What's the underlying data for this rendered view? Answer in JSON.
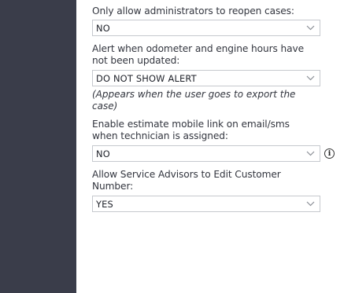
{
  "settings": [
    {
      "label": "Only allow administrators to reopen cases:",
      "value": "NO"
    },
    {
      "label": "Alert when odometer and engine hours have not been updated:",
      "value": "DO NOT SHOW ALERT",
      "note": "(Appears when the user goes to export the case)"
    },
    {
      "label": "Enable estimate mobile link on email/sms when technician is assigned:",
      "value": "NO",
      "info_icon": "info-icon"
    },
    {
      "label": "Allow Service Advisors to Edit Customer Number:",
      "value": "YES"
    }
  ]
}
